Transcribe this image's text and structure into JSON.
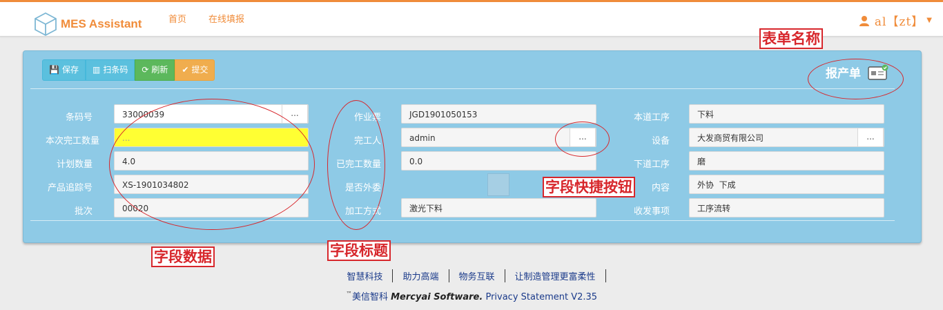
{
  "navbar": {
    "brand": "MES Assistant",
    "links": [
      "首页",
      "在线填报"
    ],
    "user": "al【zt】"
  },
  "toolbar": {
    "save": "保存",
    "scan": "扫条码",
    "refresh": "刷新",
    "submit": "提交"
  },
  "form": {
    "name": "报产单",
    "left": [
      {
        "label": "条码号",
        "value": "33000039"
      },
      {
        "label": "本次完工数量",
        "value": "..."
      },
      {
        "label": "计划数量",
        "value": "4.0"
      },
      {
        "label": "产品追踪号",
        "value": "XS-1901034802"
      },
      {
        "label": "批次",
        "value": "00020"
      }
    ],
    "middle": [
      {
        "label": "作业票",
        "value": "JGD1901050153"
      },
      {
        "label": "完工人",
        "value": "admin"
      },
      {
        "label": "已完工数量",
        "value": "0.0"
      },
      {
        "label": "是否外委",
        "value": ""
      },
      {
        "label": "加工方式",
        "value": "激光下料"
      }
    ],
    "right": [
      {
        "label": "本道工序",
        "value": "下料"
      },
      {
        "label": "设备",
        "value": "大发商贸有限公司"
      },
      {
        "label": "下道工序",
        "value": "磨"
      },
      {
        "label": "内容",
        "value": "外协  下成"
      },
      {
        "label": "收发事项",
        "value": "工序流转"
      }
    ],
    "dots": "..."
  },
  "annotations": {
    "form_name": "表单名称",
    "field_data": "字段数据",
    "field_title": "字段标题",
    "field_shortcut": "字段快捷按钮"
  },
  "footer": {
    "links": [
      "智慧科技",
      "助力高端",
      "物务互联",
      "让制造管理更富柔性"
    ],
    "tm": "™",
    "company_cn": "美信智科",
    "company_en": "Mercyai Software.",
    "privacy": "Privacy Statement V2.35"
  },
  "colors": {
    "accent": "#f08c3a",
    "panel": "#8ecae6",
    "highlight_field": "#ffff33",
    "annotation": "#d7262b"
  }
}
